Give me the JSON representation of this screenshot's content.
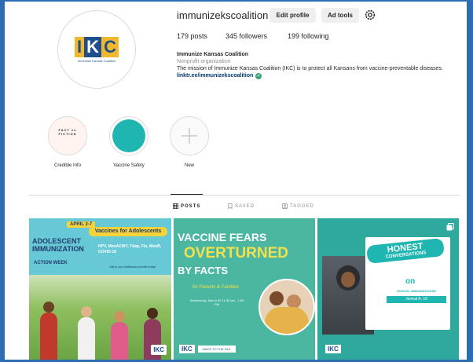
{
  "profile": {
    "username": "immunizekscoalition",
    "edit_profile_label": "Edit profile",
    "ad_tools_label": "Ad tools",
    "logo_text": [
      "I",
      "K",
      "C"
    ],
    "logo_subtitle": "Immunize Kansas Coalition",
    "stats": {
      "posts": "179 posts",
      "followers": "345 followers",
      "following": "199 following"
    },
    "bio": {
      "name": "Immunize Kansas Coalition",
      "category": "Nonprofit organization",
      "description": "The mission of Immunize Kansas Coalition (IKC) is to protect all Kansans from vaccine-preventable diseases.",
      "link": "linktr.ee/immunizekscoalition"
    }
  },
  "highlights": [
    {
      "label": "Credible Info",
      "cover_text": "FACT vs FICTION"
    },
    {
      "label": "Vaccine Safety"
    },
    {
      "label": "New"
    }
  ],
  "tabs": [
    {
      "label": "POSTS",
      "active": true,
      "icon": "grid-icon"
    },
    {
      "label": "SAVED",
      "active": false,
      "icon": "bookmark-icon"
    },
    {
      "label": "TAGGED",
      "active": false,
      "icon": "tag-icon"
    }
  ],
  "posts": [
    {
      "date_badge": "APRIL 2-7",
      "title": "ADOLESCENT IMMUNIZATION",
      "week": "ACTION WEEK",
      "headline": "Vaccines for Adolescents",
      "list": "HPV, MenACWY, Tdap, Flu, MenB, COVID-19",
      "note": "Talk to your healthcare provider today!",
      "logo": "IKC"
    },
    {
      "title_line1": "VACCINE FEARS",
      "title_line2": "OVERTURNED",
      "title_line3": "BY FACTS",
      "subtitle": "for Parents & Families",
      "date_text": "Wednesday, March 20 11:30 am - 1:00 PM",
      "logo": "IKC",
      "badge": "BACK TO THE FAX"
    },
    {
      "headline_1": "HONEST",
      "headline_2": "CONVERSATIONS",
      "connector": "on",
      "topic": "SCHOOL IMMUNIZATIONS",
      "date_text": "Jermal A. 10",
      "logo": "IKC"
    }
  ],
  "colors": {
    "frame": "#2f6db3",
    "brand_blue": "#1f4e8c",
    "brand_gold": "#f1b82d",
    "teal": "#1fb5b0",
    "link": "#00376b"
  }
}
